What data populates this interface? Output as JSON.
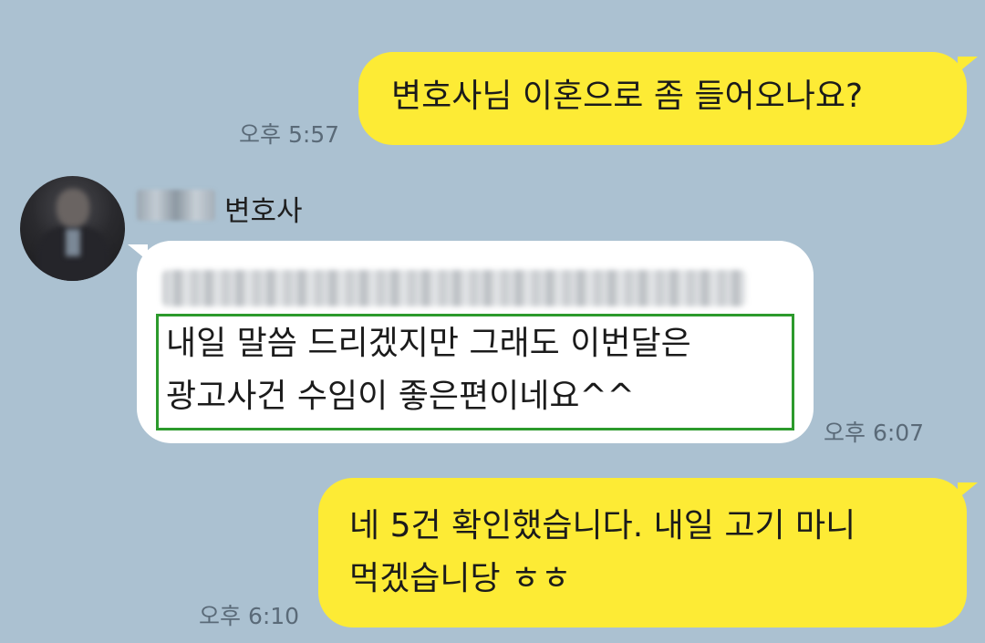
{
  "messages": [
    {
      "direction": "outgoing",
      "lines": [
        "변호사님 이혼으로 좀 들어오나요?"
      ],
      "time": "오후 5:57"
    },
    {
      "direction": "incoming",
      "sender": "변호사",
      "lines": [
        "내일 말씀 드리겠지만 그래도 이번달은",
        "광고사건 수임이 좋은편이네요^^"
      ],
      "time": "오후 6:07"
    },
    {
      "direction": "outgoing",
      "lines": [
        "네 5건 확인했습니다. 내일 고기 마니",
        "먹겠습니당 ㅎㅎ"
      ],
      "time": "오후 6:10"
    }
  ],
  "colors": {
    "background": "#abc1d1",
    "outgoing_bubble": "#fdeb35",
    "incoming_bubble": "#ffffff",
    "highlight_border": "#2c9a2c"
  }
}
